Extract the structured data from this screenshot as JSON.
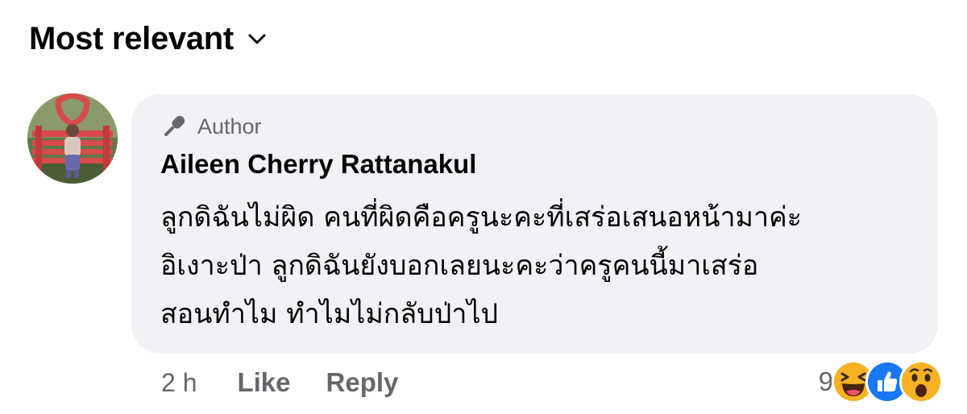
{
  "sort": {
    "label": "Most relevant",
    "icon": "chevron-down-icon"
  },
  "comment": {
    "avatar": "profile-photo-avatar",
    "badge": {
      "icon": "microphone-icon",
      "label": "Author"
    },
    "author_name": "Aileen Cherry Rattanakul",
    "text_lines": [
      "ลูกดิฉันไม่ผิด คนที่ผิดคือครูนะคะที่เสร่อเสนอหน้ามาค่ะ",
      "อิเงาะป่า ลูกดิฉันยังบอกเลยนะคะว่าครูคนนี้มาเสร่อ",
      "สอนทำไม ทำไมไม่กลับป่าไป"
    ],
    "timestamp": "2 h",
    "like_label": "Like",
    "reply_label": "Reply",
    "reactions": {
      "count": "9",
      "types": [
        "laughing-emoji-icon",
        "like-thumbs-up-icon",
        "wow-emoji-icon"
      ]
    }
  },
  "colors": {
    "bubble_background": "#f0f2f5",
    "secondary_text": "#65676b",
    "primary_text": "#050505",
    "like_blue": "#1877f2",
    "emoji_yellow": "#f7b125"
  }
}
